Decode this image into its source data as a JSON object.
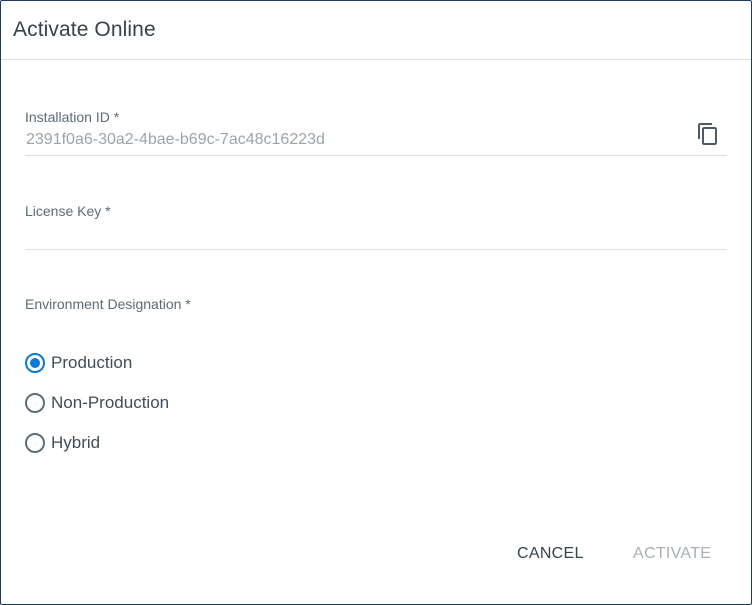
{
  "dialog": {
    "title": "Activate Online"
  },
  "installation_id": {
    "label": "Installation ID *",
    "value": "2391f0a6-30a2-4bae-b69c-7ac48c16223d",
    "copy_icon": "copy-icon"
  },
  "license_key": {
    "label": "License Key *",
    "value": "",
    "placeholder": ""
  },
  "environment": {
    "label": "Environment Designation *",
    "options": [
      {
        "label": "Production",
        "checked": true
      },
      {
        "label": "Non-Production",
        "checked": false
      },
      {
        "label": "Hybrid",
        "checked": false
      }
    ]
  },
  "actions": {
    "cancel_label": "CANCEL",
    "activate_label": "ACTIVATE"
  },
  "colors": {
    "accent": "#0a7ad6",
    "text": "#33434f",
    "muted": "#9aa4ab",
    "disabled": "#a8b0b6"
  }
}
